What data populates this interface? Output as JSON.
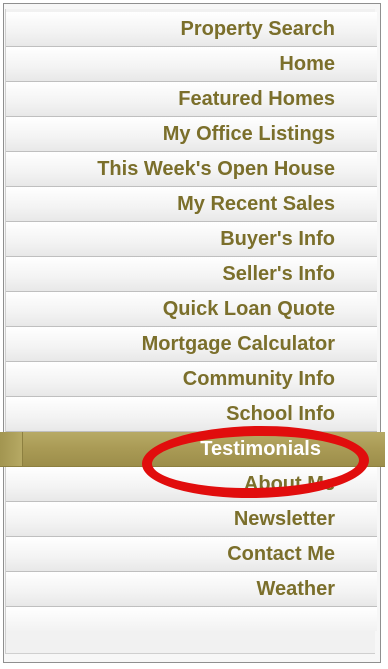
{
  "menu": {
    "items": [
      {
        "label": "Property Search"
      },
      {
        "label": "Home"
      },
      {
        "label": "Featured Homes"
      },
      {
        "label": "My Office Listings"
      },
      {
        "label": "This Week's Open House"
      },
      {
        "label": "My Recent Sales"
      },
      {
        "label": "Buyer's Info"
      },
      {
        "label": "Seller's Info"
      },
      {
        "label": "Quick Loan Quote"
      },
      {
        "label": "Mortgage Calculator"
      },
      {
        "label": "Community Info"
      },
      {
        "label": "School Info"
      },
      {
        "label": "Testimonials"
      },
      {
        "label": "About Me"
      },
      {
        "label": "Newsletter"
      },
      {
        "label": "Contact Me"
      },
      {
        "label": "Weather"
      }
    ],
    "active_item": "Testimonials",
    "accent_color": "#7b6f2b",
    "active_color": "#a99a55",
    "highlight_ring_color": "#e10d0d"
  }
}
